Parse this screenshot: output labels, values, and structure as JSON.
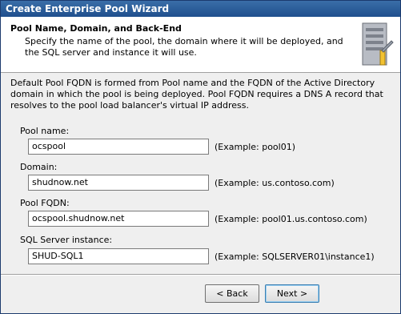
{
  "window": {
    "title": "Create Enterprise Pool Wizard"
  },
  "header": {
    "title": "Pool Name, Domain, and Back-End",
    "description": "Specify the name of the pool, the domain where it will be deployed, and the SQL server and instance it will use.",
    "icon": "server-icon"
  },
  "intro": "Default Pool FQDN is formed from Pool name and the FQDN of the Active Directory domain in which the pool is being deployed. Pool FQDN requires a DNS A record that resolves to the pool load balancer's virtual IP address.",
  "fields": [
    {
      "label": "Pool name:",
      "value": "ocspool",
      "example": "(Example: pool01)"
    },
    {
      "label": "Domain:",
      "value": "shudnow.net",
      "example": "(Example: us.contoso.com)"
    },
    {
      "label": "Pool FQDN:",
      "value": "ocspool.shudnow.net",
      "example": "(Example: pool01.us.contoso.com)"
    },
    {
      "label": "SQL Server instance:",
      "value": "SHUD-SQL1",
      "example": "(Example: SQLSERVER01\\instance1)"
    }
  ],
  "buttons": {
    "back": "< Back",
    "next": "Next >"
  }
}
